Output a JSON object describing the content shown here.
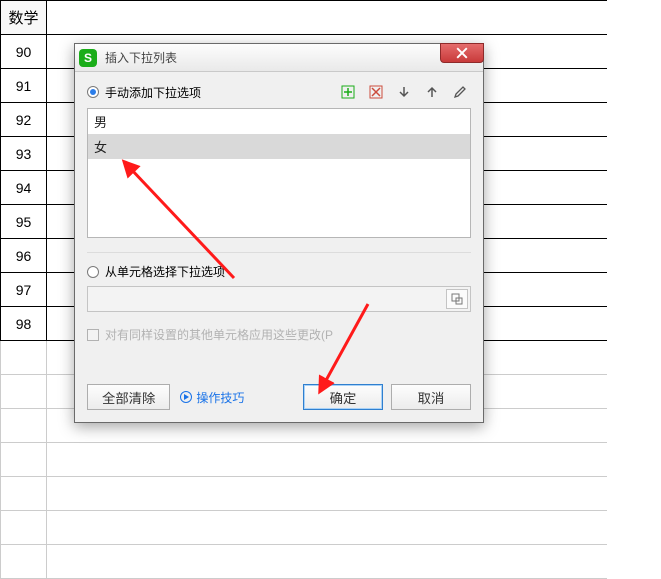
{
  "sheet": {
    "header": "数学",
    "values": [
      "90",
      "91",
      "92",
      "93",
      "94",
      "95",
      "96",
      "97",
      "98"
    ]
  },
  "dialog": {
    "title": "插入下拉列表",
    "radio_manual": "手动添加下拉选项",
    "radio_range": "从单元格选择下拉选项",
    "options": [
      "男",
      "女"
    ],
    "selected_index": 1,
    "apply_same_label": "对有同样设置的其他单元格应用这些更改(P",
    "clear_all": "全部清除",
    "tips": "操作技巧",
    "ok": "确定",
    "cancel": "取消"
  },
  "icons": {
    "add": "add-icon",
    "delete": "delete-icon",
    "move_down": "arrow-down-icon",
    "move_up": "arrow-up-icon",
    "edit": "pencil-icon",
    "range_picker": "range-picker-icon",
    "close": "close-icon",
    "app": "S"
  }
}
